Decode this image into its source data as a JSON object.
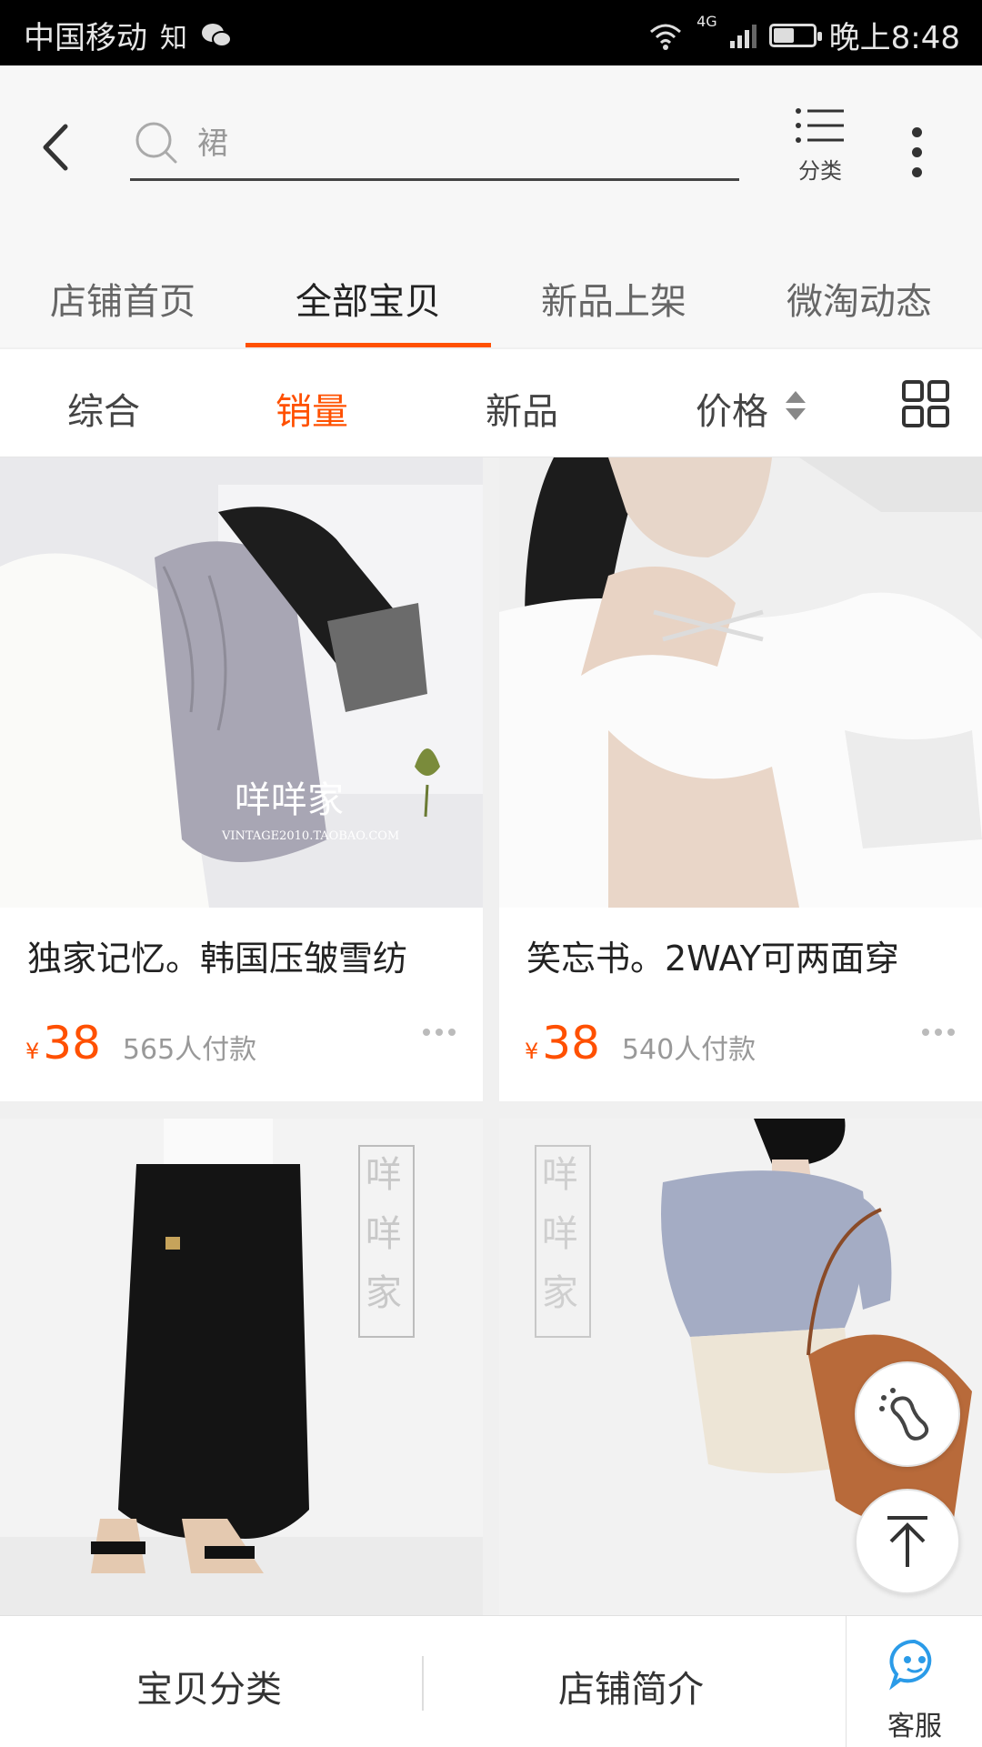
{
  "status_bar": {
    "carrier": "中国移动",
    "app_label": "知",
    "network": "4G",
    "time": "晚上8:48",
    "battery_level": 0.55
  },
  "header": {
    "search_placeholder": "裙",
    "category_label": "分类"
  },
  "tabs": [
    {
      "label": "店铺首页",
      "active": false
    },
    {
      "label": "全部宝贝",
      "active": true
    },
    {
      "label": "新品上架",
      "active": false
    },
    {
      "label": "微淘动态",
      "active": false
    }
  ],
  "sort": {
    "items": [
      "综合",
      "销量",
      "新品",
      "价格"
    ],
    "active": "销量"
  },
  "products": [
    {
      "title": "独家记忆。韩国压皱雪纺",
      "currency": "¥",
      "price": "38",
      "sold": "565人付款"
    },
    {
      "title": "笑忘书。2WAY可两面穿",
      "currency": "¥",
      "price": "38",
      "sold": "540人付款"
    },
    {
      "title": "",
      "currency": "",
      "price": "",
      "sold": ""
    },
    {
      "title": "",
      "currency": "",
      "price": "",
      "sold": ""
    }
  ],
  "watermarks": {
    "brand": "咩咩家",
    "site": "VINTAGE2010.TAOBAO.COM"
  },
  "bottom_bar": {
    "category_label": "宝贝分类",
    "intro_label": "店铺简介",
    "service_label": "客服"
  },
  "colors": {
    "accent": "#ff5000",
    "service_blue": "#2b9be8"
  },
  "icons": [
    "back-arrow-icon",
    "search-icon",
    "list-icon",
    "more-vertical-icon",
    "sort-arrows-icon",
    "grid-view-icon",
    "footprint-icon",
    "arrow-up-icon",
    "customer-service-icon",
    "wifi-icon",
    "signal-icon",
    "battery-icon",
    "wechat-icon"
  ]
}
